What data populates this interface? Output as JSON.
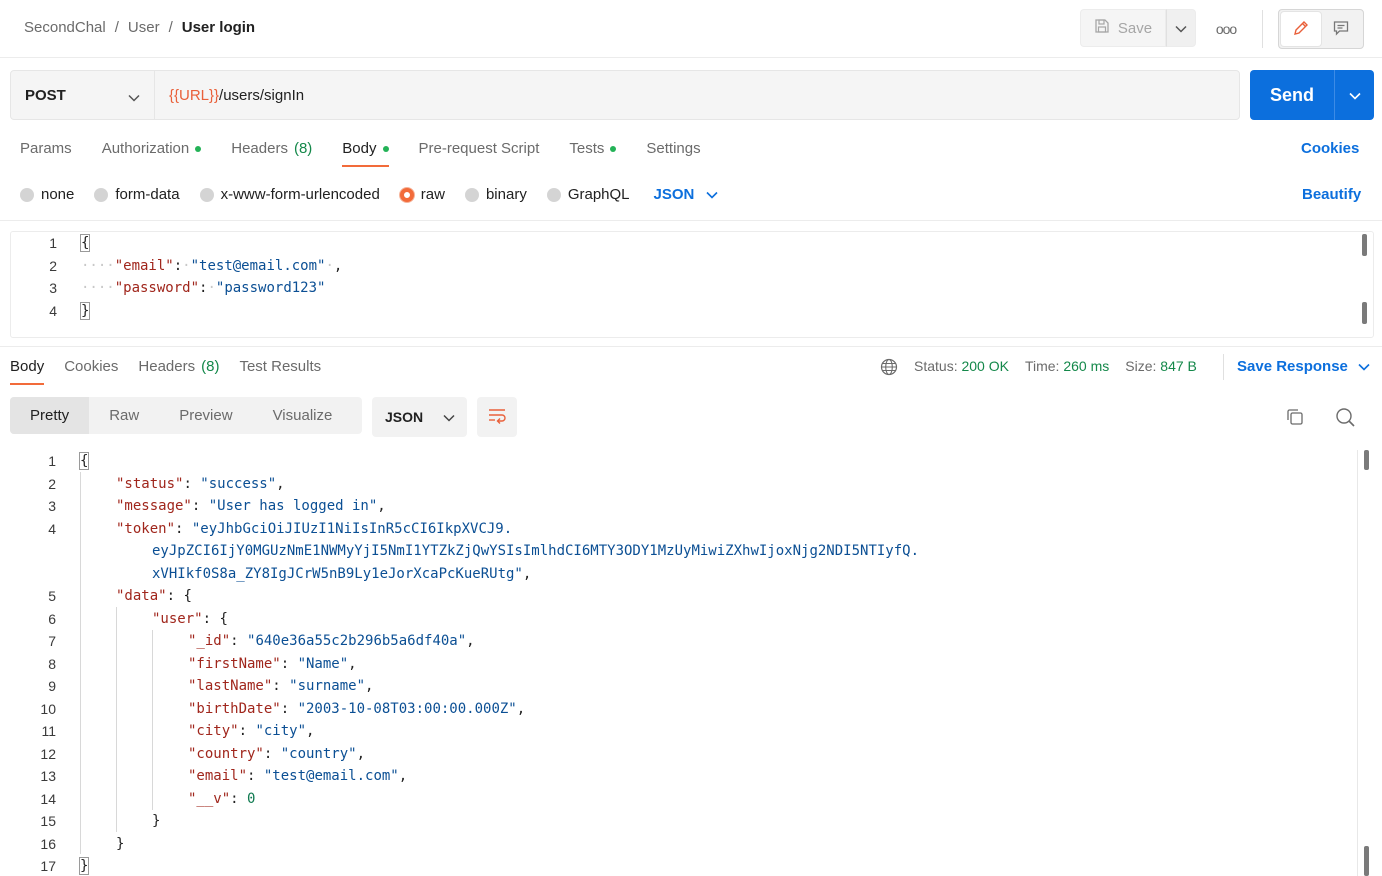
{
  "breadcrumb": {
    "items": [
      "SecondChal",
      "User"
    ],
    "current": "User login"
  },
  "toolbar": {
    "save_label": "Save",
    "more_label": "ooo"
  },
  "request": {
    "method": "POST",
    "url_var": "{{URL}}",
    "url_path": "/users/signIn",
    "send_label": "Send"
  },
  "req_tabs": {
    "params": "Params",
    "authorization": "Authorization",
    "headers": "Headers",
    "headers_count": "(8)",
    "body": "Body",
    "prerequest": "Pre-request Script",
    "tests": "Tests",
    "settings": "Settings",
    "cookies": "Cookies"
  },
  "body_types": {
    "none": "none",
    "form_data": "form-data",
    "urlencoded": "x-www-form-urlencoded",
    "raw": "raw",
    "binary": "binary",
    "graphql": "GraphQL",
    "language": "JSON",
    "beautify": "Beautify"
  },
  "request_body": {
    "line_numbers": [
      "1",
      "2",
      "3",
      "4"
    ],
    "open": "{",
    "email_key": "\"email\"",
    "email_val": "\"test@email.com\"",
    "password_key": "\"password\"",
    "password_val": "\"password123\"",
    "close": "}"
  },
  "resp_tabs": {
    "body": "Body",
    "cookies": "Cookies",
    "headers": "Headers",
    "headers_count": "(8)",
    "test_results": "Test Results"
  },
  "response_meta": {
    "status_label": "Status:",
    "status_value": "200 OK",
    "time_label": "Time:",
    "time_value": "260 ms",
    "size_label": "Size:",
    "size_value": "847 B",
    "save_response": "Save Response"
  },
  "view_modes": {
    "pretty": "Pretty",
    "raw": "Raw",
    "preview": "Preview",
    "visualize": "Visualize",
    "format": "JSON"
  },
  "response_body": {
    "line_numbers": [
      "1",
      "2",
      "3",
      "4",
      "",
      "",
      "5",
      "6",
      "7",
      "8",
      "9",
      "10",
      "11",
      "12",
      "13",
      "14",
      "15",
      "16",
      "17"
    ],
    "lines": [
      {
        "indent": 0,
        "key": "",
        "val": "",
        "raw": "{"
      },
      {
        "indent": 1,
        "key": "\"status\"",
        "val": "\"success\"",
        "vtype": "s",
        "tail": ","
      },
      {
        "indent": 1,
        "key": "\"message\"",
        "val": "\"User has logged in\"",
        "vtype": "s",
        "tail": ","
      },
      {
        "indent": 1,
        "key": "\"token\"",
        "val": "\"eyJhbGciOiJIUzI1NiIsInR5cCI6IkpXVCJ9.",
        "vtype": "s",
        "tail": ""
      },
      {
        "indent": 2,
        "key": "",
        "val": "eyJpZCI6IjY0MGUzNmE1NWMyYjI5NmI1YTZkZjQwYSIsImlhdCI6MTY3ODY1MzUyMiwiZXhwIjoxNjg2NDI5NTIyfQ.",
        "vtype": "s",
        "tail": ""
      },
      {
        "indent": 2,
        "key": "",
        "val": "xVHIkf0S8a_ZY8IgJCrW5nB9Ly1eJorXcaPcKueRUtg\"",
        "vtype": "s",
        "tail": ","
      },
      {
        "indent": 1,
        "key": "\"data\"",
        "val": "",
        "raw_after": "{"
      },
      {
        "indent": 2,
        "key": "\"user\"",
        "val": "",
        "raw_after": "{"
      },
      {
        "indent": 3,
        "key": "\"_id\"",
        "val": "\"640e36a55c2b296b5a6df40a\"",
        "vtype": "s",
        "tail": ","
      },
      {
        "indent": 3,
        "key": "\"firstName\"",
        "val": "\"Name\"",
        "vtype": "s",
        "tail": ","
      },
      {
        "indent": 3,
        "key": "\"lastName\"",
        "val": "\"surname\"",
        "vtype": "s",
        "tail": ","
      },
      {
        "indent": 3,
        "key": "\"birthDate\"",
        "val": "\"2003-10-08T03:00:00.000Z\"",
        "vtype": "s",
        "tail": ","
      },
      {
        "indent": 3,
        "key": "\"city\"",
        "val": "\"city\"",
        "vtype": "s",
        "tail": ","
      },
      {
        "indent": 3,
        "key": "\"country\"",
        "val": "\"country\"",
        "vtype": "s",
        "tail": ","
      },
      {
        "indent": 3,
        "key": "\"email\"",
        "val": "\"test@email.com\"",
        "vtype": "s",
        "tail": ","
      },
      {
        "indent": 3,
        "key": "\"__v\"",
        "val": "0",
        "vtype": "n",
        "tail": ""
      },
      {
        "indent": 2,
        "key": "",
        "val": "",
        "raw": "}"
      },
      {
        "indent": 1,
        "key": "",
        "val": "",
        "raw": "}"
      },
      {
        "indent": 0,
        "key": "",
        "val": "",
        "raw": "}"
      }
    ]
  },
  "colors": {
    "accent": "#0c6fdd",
    "tab_active": "#f26b3a",
    "success": "#14884a",
    "url_var": "#e9603a"
  }
}
